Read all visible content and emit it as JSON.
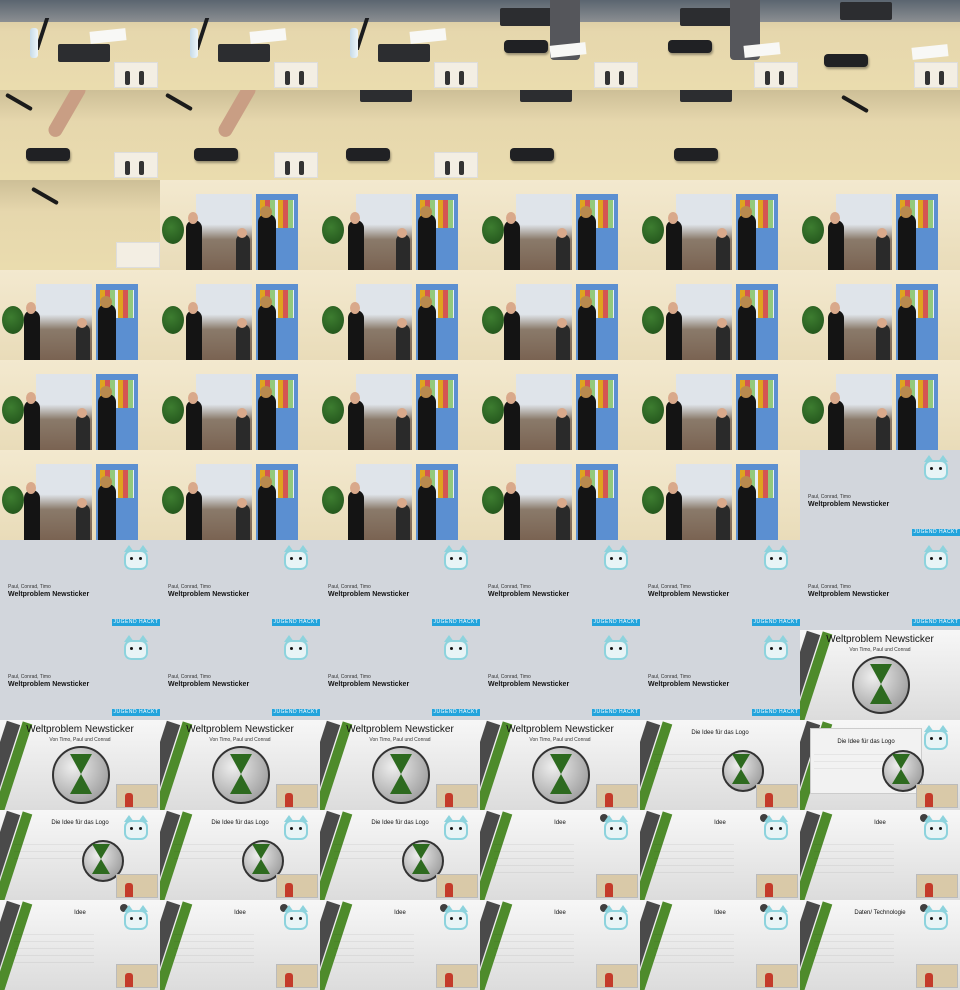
{
  "grid": {
    "columns": 6,
    "rows": 11
  },
  "title_slide": {
    "names": "Paul, Conrad, Timo",
    "title": "Weltproblem Newsticker",
    "logo": "JUGEND HACKT"
  },
  "presentation": {
    "title": "Weltproblem Newsticker",
    "subtitle": "Von Timo, Paul und Conrad",
    "logo_slide_heading": "Die Idee für das Logo",
    "idea_heading": "Idee",
    "tech_heading": "Daten/ Technologie"
  },
  "frames": [
    {
      "scene": "table"
    },
    {
      "scene": "table"
    },
    {
      "scene": "table"
    },
    {
      "scene": "table"
    },
    {
      "scene": "table"
    },
    {
      "scene": "table"
    },
    {
      "scene": "table"
    },
    {
      "scene": "table"
    },
    {
      "scene": "table"
    },
    {
      "scene": "table"
    },
    {
      "scene": "table"
    },
    {
      "scene": "table"
    },
    {
      "scene": "table"
    },
    {
      "scene": "stage"
    },
    {
      "scene": "stage"
    },
    {
      "scene": "stage"
    },
    {
      "scene": "stage"
    },
    {
      "scene": "stage"
    },
    {
      "scene": "stage"
    },
    {
      "scene": "stage"
    },
    {
      "scene": "stage"
    },
    {
      "scene": "stage"
    },
    {
      "scene": "stage"
    },
    {
      "scene": "stage"
    },
    {
      "scene": "stage"
    },
    {
      "scene": "stage"
    },
    {
      "scene": "stage"
    },
    {
      "scene": "stage"
    },
    {
      "scene": "stage"
    },
    {
      "scene": "stage"
    },
    {
      "scene": "stage"
    },
    {
      "scene": "stage"
    },
    {
      "scene": "stage"
    },
    {
      "scene": "stage"
    },
    {
      "scene": "stage"
    },
    {
      "scene": "title"
    },
    {
      "scene": "title"
    },
    {
      "scene": "title"
    },
    {
      "scene": "title"
    },
    {
      "scene": "title"
    },
    {
      "scene": "title"
    },
    {
      "scene": "title"
    },
    {
      "scene": "title"
    },
    {
      "scene": "title"
    },
    {
      "scene": "title"
    },
    {
      "scene": "title"
    },
    {
      "scene": "title"
    },
    {
      "scene": "cover"
    },
    {
      "scene": "cover"
    },
    {
      "scene": "cover"
    },
    {
      "scene": "cover"
    },
    {
      "scene": "cover"
    },
    {
      "scene": "logo"
    },
    {
      "scene": "logo"
    },
    {
      "scene": "logo"
    },
    {
      "scene": "logo"
    },
    {
      "scene": "logo"
    },
    {
      "scene": "idea"
    },
    {
      "scene": "idea"
    },
    {
      "scene": "idea"
    },
    {
      "scene": "idea"
    },
    {
      "scene": "idea"
    },
    {
      "scene": "idea"
    },
    {
      "scene": "idea"
    },
    {
      "scene": "idea"
    },
    {
      "scene": "tech"
    }
  ]
}
